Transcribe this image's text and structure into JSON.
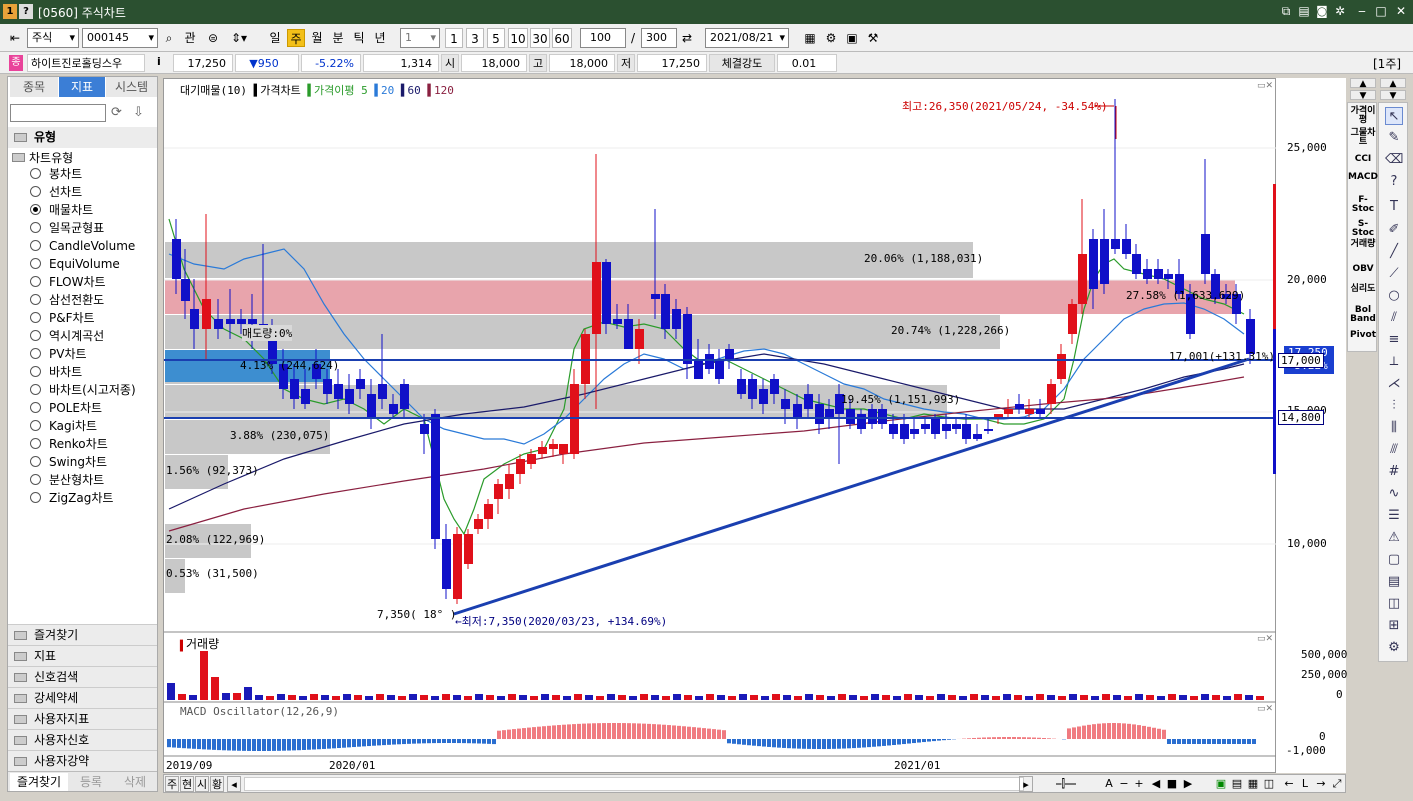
{
  "window": {
    "title": "[0560] 주식차트",
    "icon1": "1",
    "icon2": "?"
  },
  "toolbar": {
    "market": "주식",
    "code": "000145",
    "search_btn": "관",
    "periods": [
      "일",
      "주",
      "월",
      "분",
      "틱",
      "년"
    ],
    "minute_value": "1",
    "quick_counts": [
      "1",
      "3",
      "5",
      "10",
      "30",
      "60"
    ],
    "display_count": "100",
    "slash": "/",
    "total_count": "300",
    "date": "2021/08/21"
  },
  "quote": {
    "name": "하이트진로홀딩스우",
    "info": "i",
    "price": "17,250",
    "change": "▼950",
    "rate": "-5.22%",
    "volume": "1,314",
    "open_label": "시",
    "open": "18,000",
    "high_label": "고",
    "high": "18,000",
    "low_label": "저",
    "low": "17,250",
    "strength_label": "체결강도",
    "strength": "0.01",
    "unit": "[1주]"
  },
  "left": {
    "tabs": [
      "종목",
      "지표",
      "시스템"
    ],
    "section": "유형",
    "group": "차트유형",
    "chart_types": [
      "봉차트",
      "선차트",
      "매물차트",
      "일목균형표",
      "CandleVolume",
      "EquiVolume",
      "FLOW차트",
      "삼선전환도",
      "P&F차트",
      "역시계곡선",
      "PV차트",
      "바차트",
      "바차트(시고저종)",
      "POLE차트",
      "Kagi차트",
      "Renko차트",
      "Swing차트",
      "분산형차트",
      "ZigZag차트"
    ],
    "selected_type": "매물차트",
    "folders": [
      "즐겨찾기",
      "지표",
      "신호검색",
      "강세약세",
      "사용자지표",
      "사용자신호",
      "사용자강약"
    ],
    "bottom_tabs": [
      "즐겨찾기",
      "등록",
      "삭제"
    ]
  },
  "chart": {
    "legend": [
      "대기매물(10)",
      "가격차트",
      "가격이평 5",
      "20",
      "60",
      "120"
    ],
    "high_note": "최고:26,350(2021/05/24, -34.54%)",
    "low_note": "←최저:7,350(2020/03/23, +134.69%)",
    "low_price_label": "7,350( 18° )",
    "trend_label": "17,001(+131.31%)",
    "signal_label": "매도량:0%",
    "y_ticks": [
      "25,000",
      "20,000",
      "15,000",
      "10,000"
    ],
    "price_tag": "17,250",
    "price_tag2": "-5.22%",
    "line_tag1": "17,000",
    "line_tag2": "14,800",
    "volume_profile": [
      {
        "label": "20.06% (1,188,031)",
        "highlight": false
      },
      {
        "label": "27.58% (1,633,629)",
        "highlight": true
      },
      {
        "label": "20.74% (1,228,266)",
        "highlight": false
      },
      {
        "label": "4.13% (244,624)",
        "highlight": false
      },
      {
        "label": "19.45% (1,151,993)",
        "highlight": false
      },
      {
        "label": "3.88% (230,075)",
        "highlight": false
      },
      {
        "label": "1.56% (92,373)",
        "highlight": false
      },
      {
        "label": "2.08% (122,969)",
        "highlight": false
      },
      {
        "label": "0.53% (31,500)",
        "highlight": false
      }
    ],
    "volume_title": "거래량",
    "volume_ticks": [
      "500,000",
      "250,000",
      "0"
    ],
    "macd_title": "MACD Oscillator(12,26,9)",
    "macd_ticks": [
      "0",
      "-1,000"
    ],
    "x_labels": [
      "2019/09",
      "2020/01",
      "2021/01"
    ]
  },
  "indicators": [
    "가격이평",
    "그물차트",
    "CCI",
    "MACD",
    "F-Stoc",
    "S-Stoc",
    "거래량",
    "OBV",
    "심리도",
    "Bol Band",
    "Pivot"
  ],
  "bottom": {
    "buttons": [
      "주",
      "현",
      "시",
      "황"
    ]
  }
}
